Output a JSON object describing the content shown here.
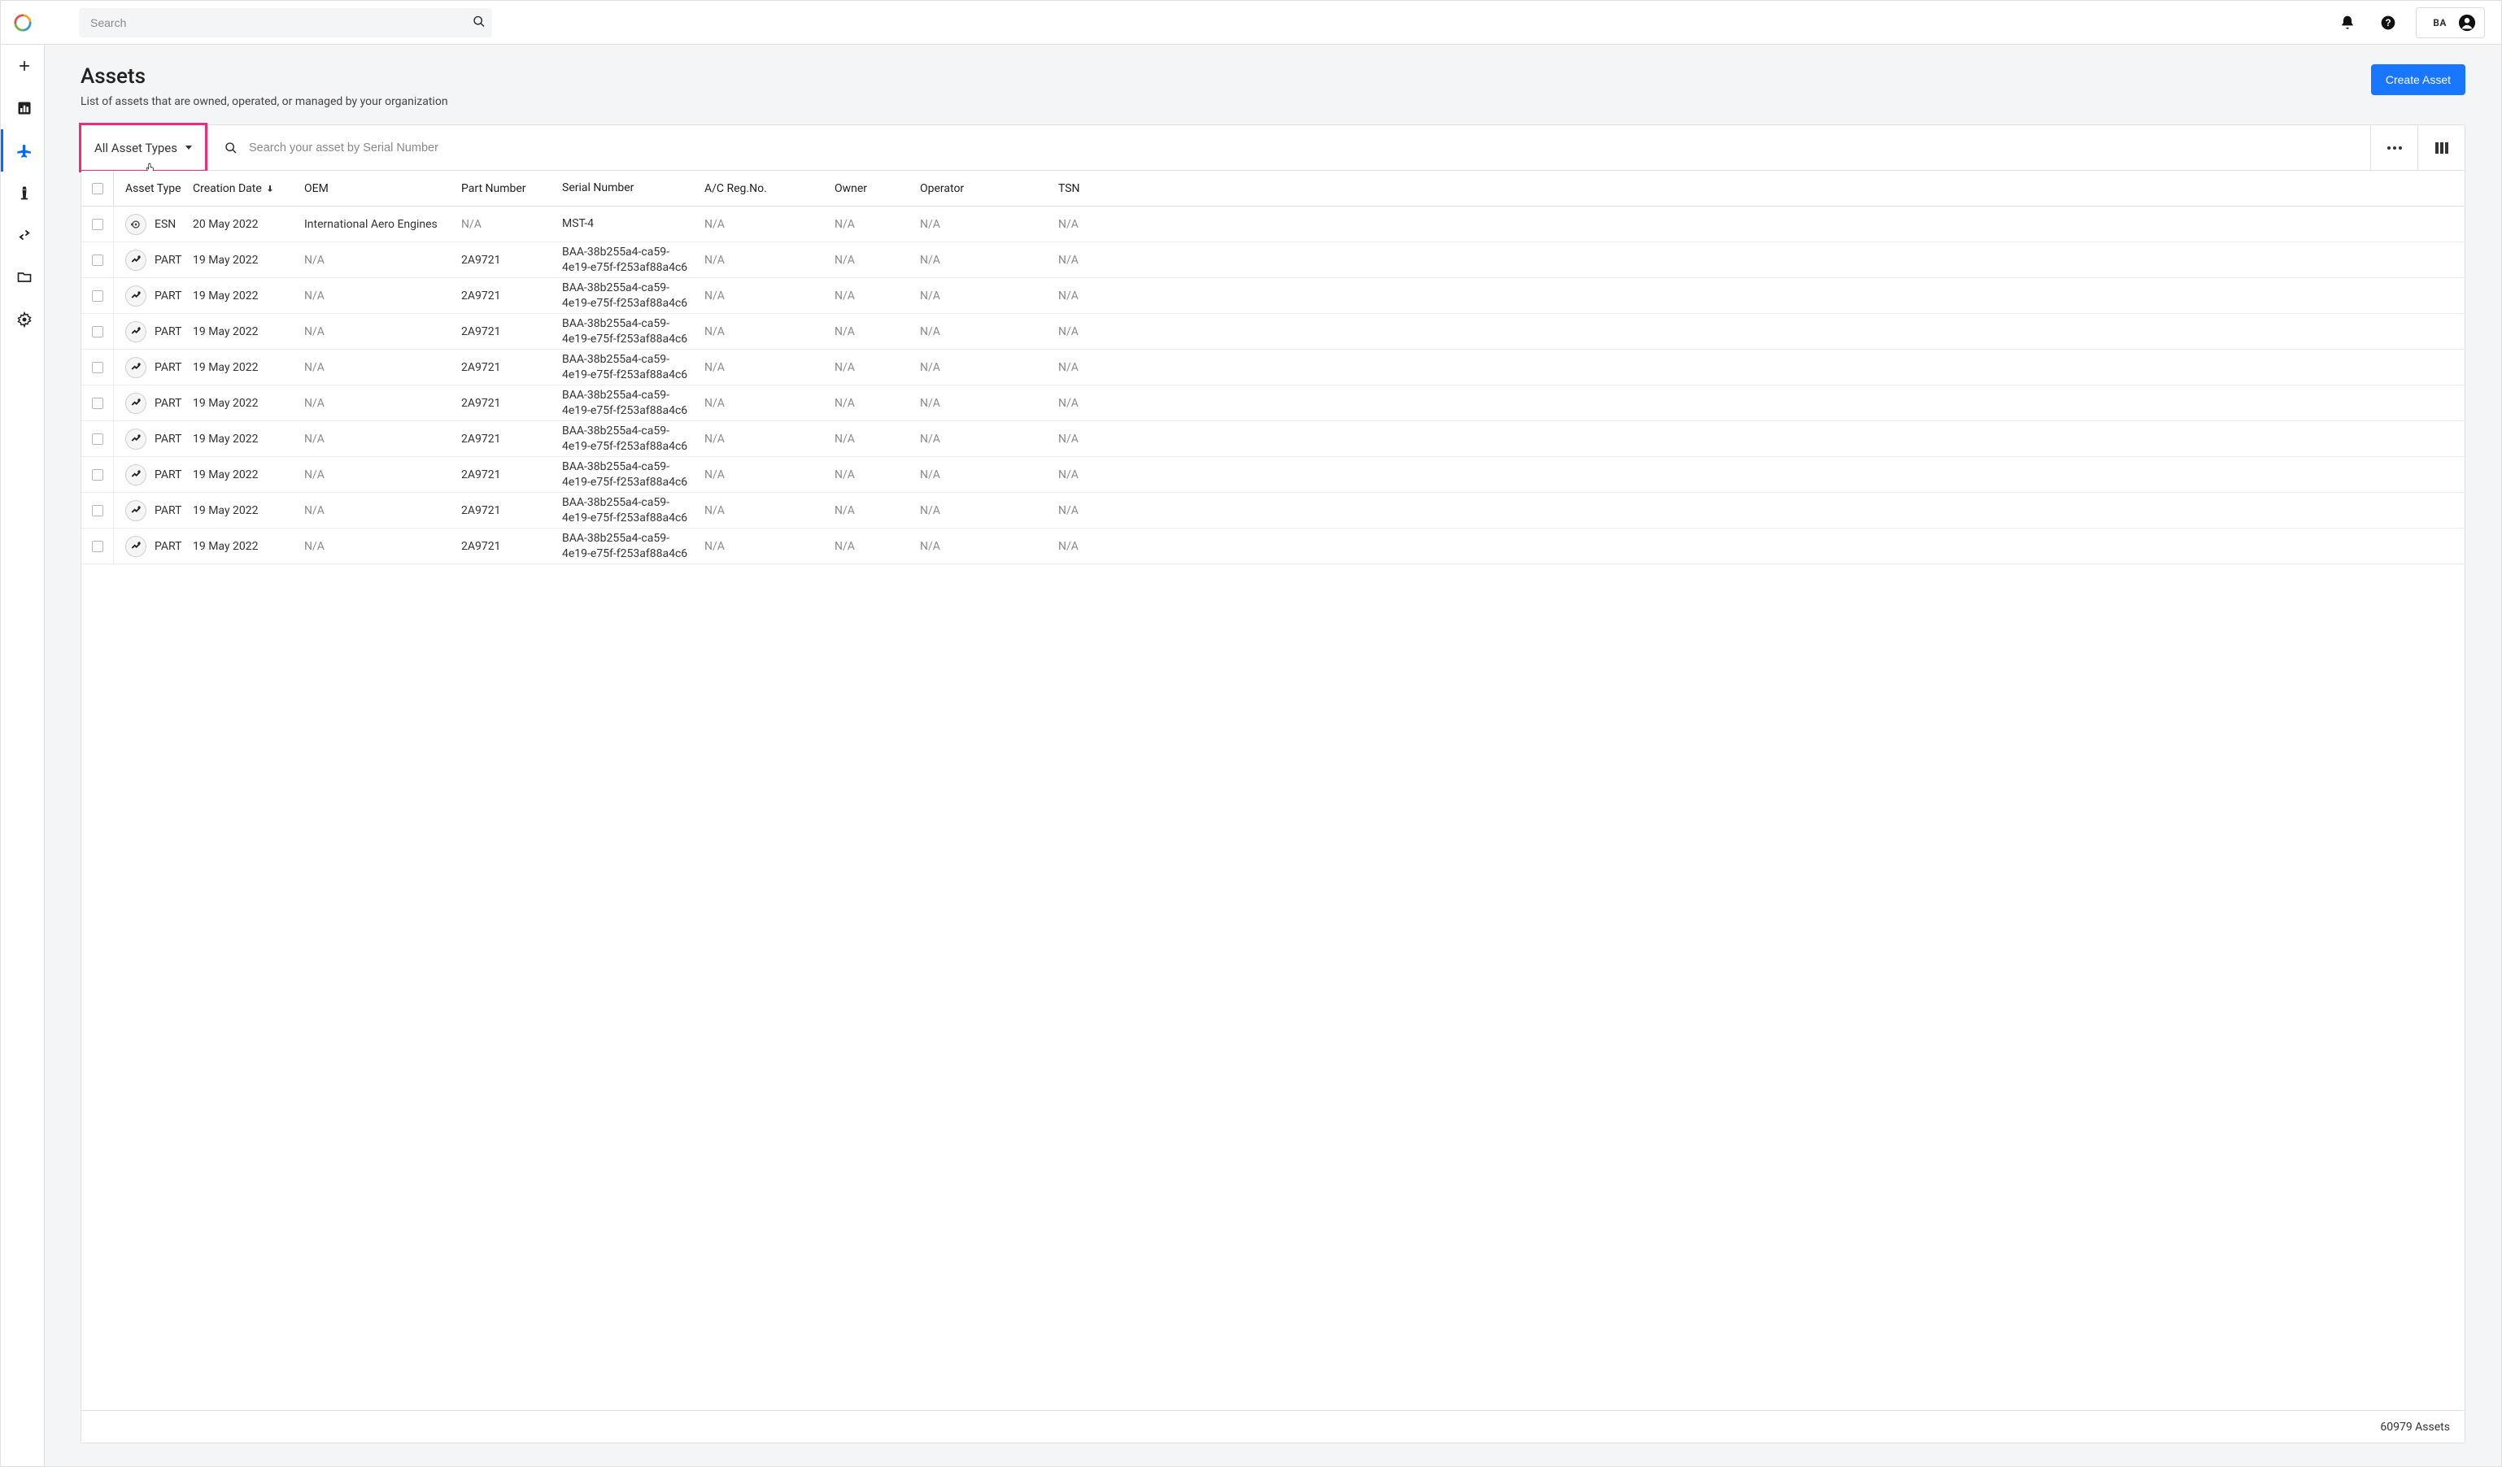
{
  "header": {
    "search_placeholder": "Search",
    "user_initials": "BA"
  },
  "page": {
    "title": "Assets",
    "subtitle": "List of assets that are owned, operated, or managed by your organization",
    "create_button": "Create Asset"
  },
  "toolbar": {
    "filter_label": "All Asset Types",
    "asset_search_placeholder": "Search your asset by Serial Number"
  },
  "columns": {
    "asset_type": "Asset Type",
    "creation_date": "Creation Date",
    "oem": "OEM",
    "part_number": "Part Number",
    "serial_number": "Serial Number",
    "ac_reg_no": "A/C Reg.No.",
    "owner": "Owner",
    "operator": "Operator",
    "tsn": "TSN"
  },
  "rows": [
    {
      "icon": "engine",
      "type": "ESN",
      "date": "20 May 2022",
      "oem": "International Aero Engines",
      "part": "N/A",
      "serial": "MST-4",
      "reg": "N/A",
      "owner": "N/A",
      "operator": "N/A",
      "tsn": "N/A"
    },
    {
      "icon": "part",
      "type": "PART",
      "date": "19 May 2022",
      "oem": "N/A",
      "part": "2A9721",
      "serial": "BAA-38b255a4-ca59-4e19-e75f-f253af88a4c6",
      "reg": "N/A",
      "owner": "N/A",
      "operator": "N/A",
      "tsn": "N/A"
    },
    {
      "icon": "part",
      "type": "PART",
      "date": "19 May 2022",
      "oem": "N/A",
      "part": "2A9721",
      "serial": "BAA-38b255a4-ca59-4e19-e75f-f253af88a4c6",
      "reg": "N/A",
      "owner": "N/A",
      "operator": "N/A",
      "tsn": "N/A"
    },
    {
      "icon": "part",
      "type": "PART",
      "date": "19 May 2022",
      "oem": "N/A",
      "part": "2A9721",
      "serial": "BAA-38b255a4-ca59-4e19-e75f-f253af88a4c6",
      "reg": "N/A",
      "owner": "N/A",
      "operator": "N/A",
      "tsn": "N/A"
    },
    {
      "icon": "part",
      "type": "PART",
      "date": "19 May 2022",
      "oem": "N/A",
      "part": "2A9721",
      "serial": "BAA-38b255a4-ca59-4e19-e75f-f253af88a4c6",
      "reg": "N/A",
      "owner": "N/A",
      "operator": "N/A",
      "tsn": "N/A"
    },
    {
      "icon": "part",
      "type": "PART",
      "date": "19 May 2022",
      "oem": "N/A",
      "part": "2A9721",
      "serial": "BAA-38b255a4-ca59-4e19-e75f-f253af88a4c6",
      "reg": "N/A",
      "owner": "N/A",
      "operator": "N/A",
      "tsn": "N/A"
    },
    {
      "icon": "part",
      "type": "PART",
      "date": "19 May 2022",
      "oem": "N/A",
      "part": "2A9721",
      "serial": "BAA-38b255a4-ca59-4e19-e75f-f253af88a4c6",
      "reg": "N/A",
      "owner": "N/A",
      "operator": "N/A",
      "tsn": "N/A"
    },
    {
      "icon": "part",
      "type": "PART",
      "date": "19 May 2022",
      "oem": "N/A",
      "part": "2A9721",
      "serial": "BAA-38b255a4-ca59-4e19-e75f-f253af88a4c6",
      "reg": "N/A",
      "owner": "N/A",
      "operator": "N/A",
      "tsn": "N/A"
    },
    {
      "icon": "part",
      "type": "PART",
      "date": "19 May 2022",
      "oem": "N/A",
      "part": "2A9721",
      "serial": "BAA-38b255a4-ca59-4e19-e75f-f253af88a4c6",
      "reg": "N/A",
      "owner": "N/A",
      "operator": "N/A",
      "tsn": "N/A"
    },
    {
      "icon": "part",
      "type": "PART",
      "date": "19 May 2022",
      "oem": "N/A",
      "part": "2A9721",
      "serial": "BAA-38b255a4-ca59-4e19-e75f-f253af88a4c6",
      "reg": "N/A",
      "owner": "N/A",
      "operator": "N/A",
      "tsn": "N/A"
    }
  ],
  "footer": {
    "count_text": "60979 Assets"
  }
}
